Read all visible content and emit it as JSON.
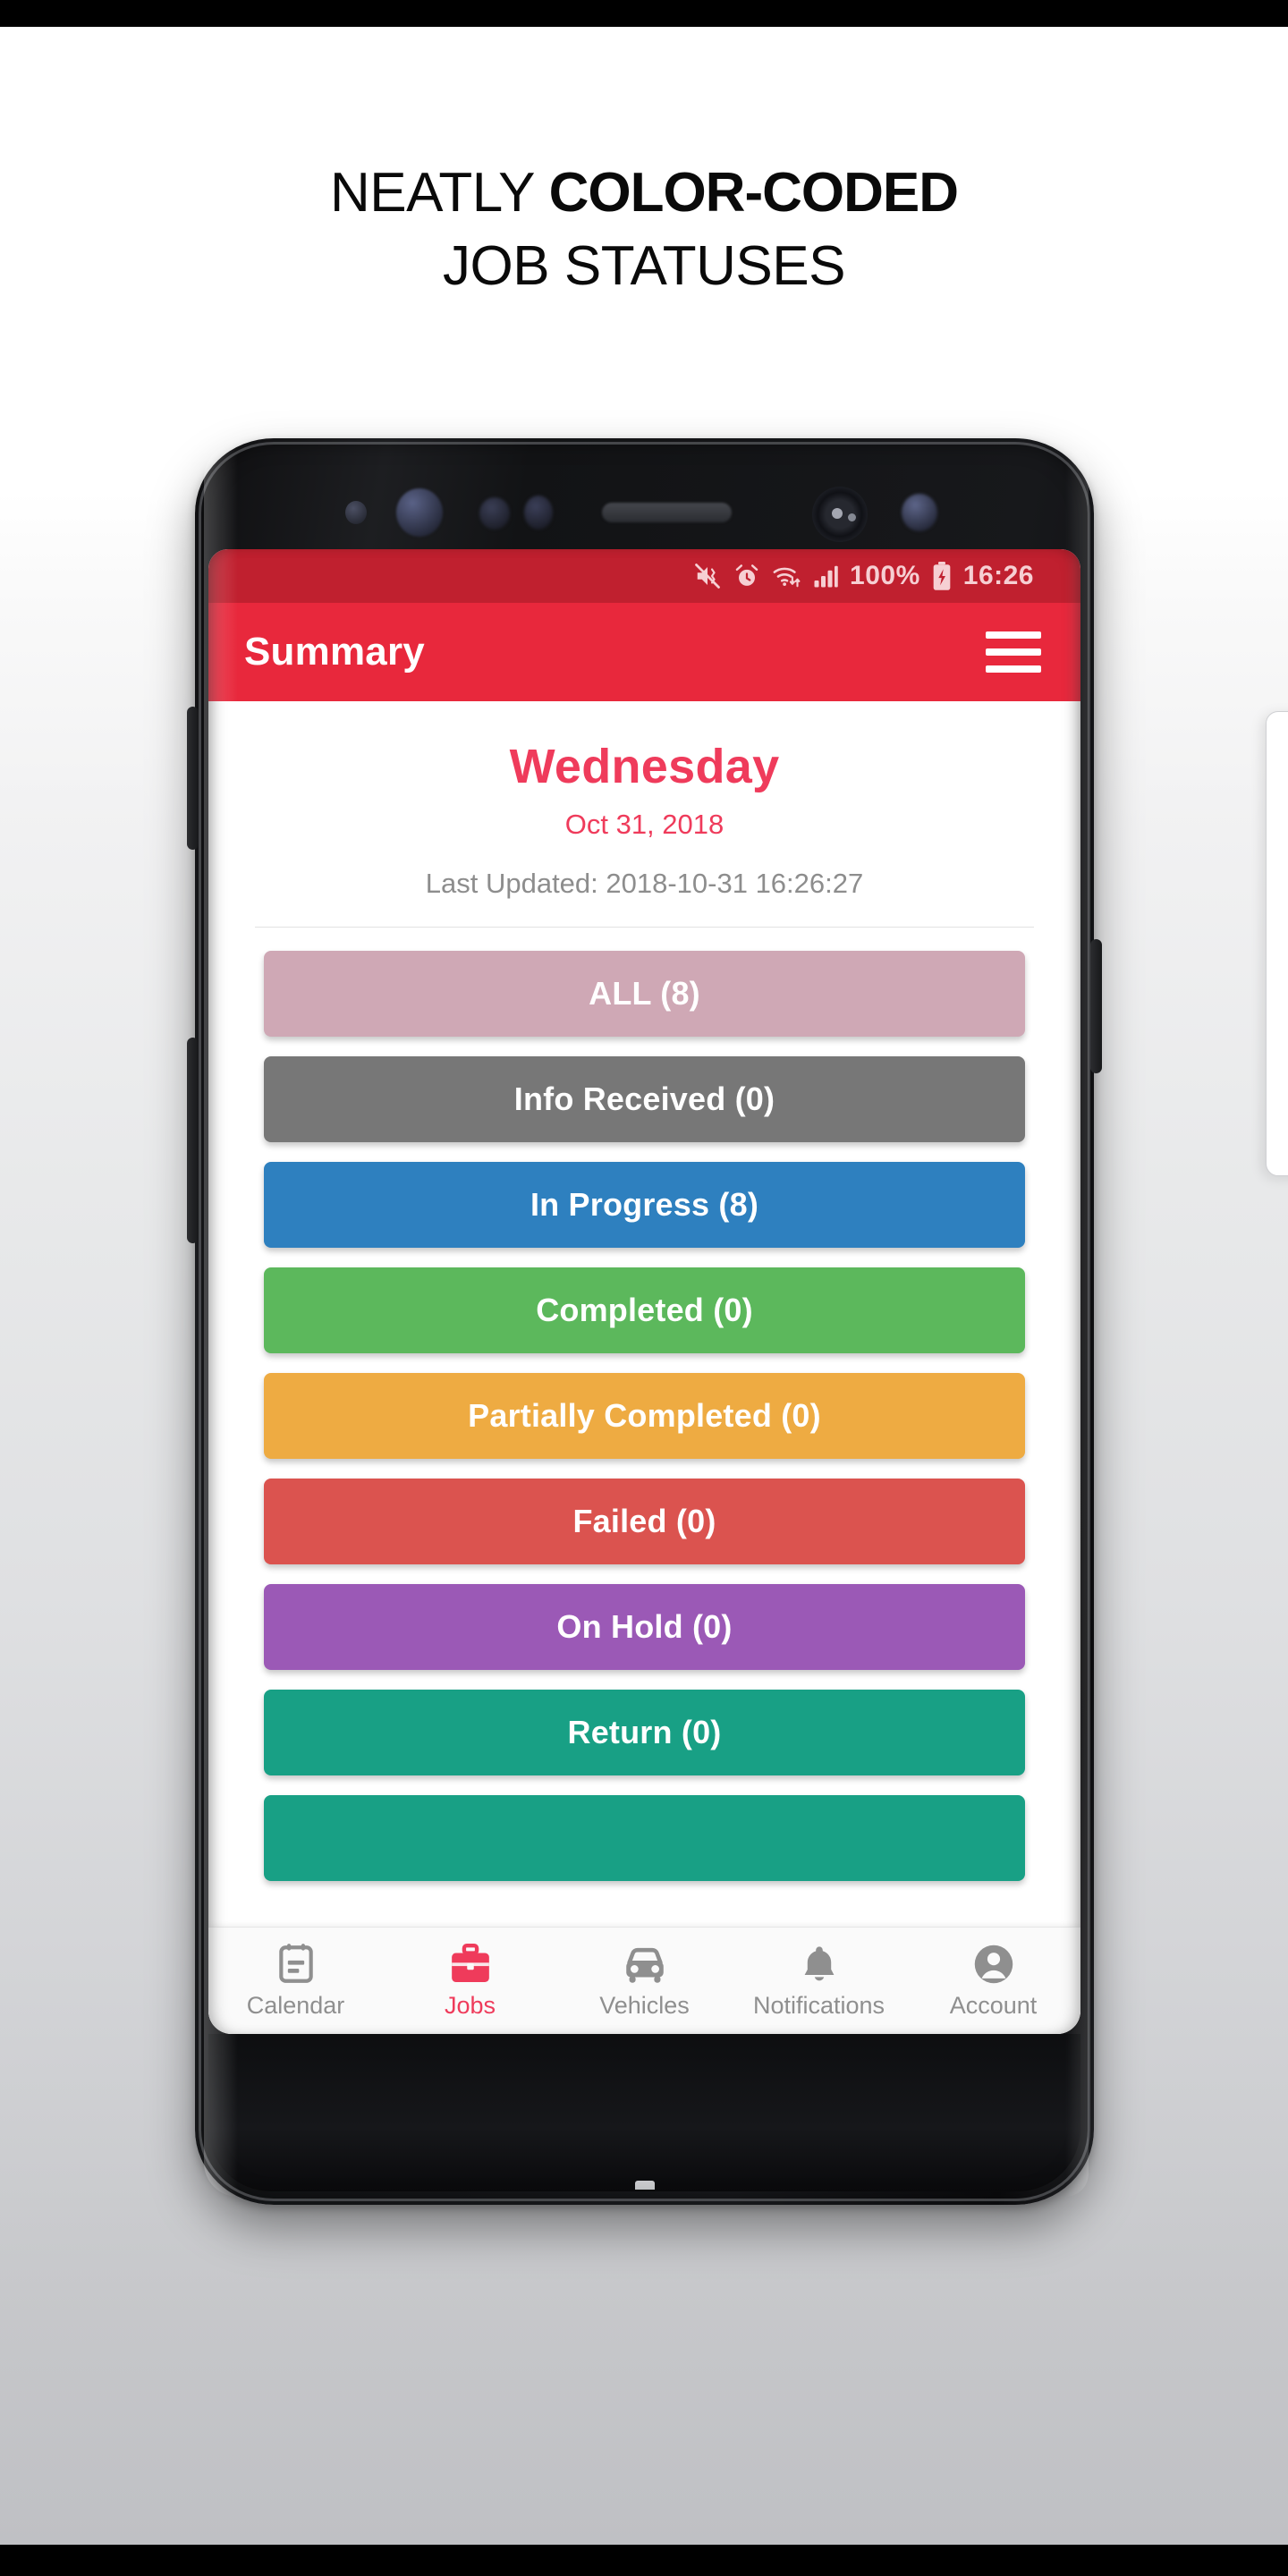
{
  "headline": {
    "line1_light": "NEATLY ",
    "line1_bold": "COLOR-CODED",
    "line2": "JOB STATUSES"
  },
  "statusbar": {
    "battery_percent": "100%",
    "time": "16:26",
    "icons": [
      "mute-vibrate-icon",
      "alarm-icon",
      "wifi-icon",
      "signal-bars-icon",
      "battery-charging-icon"
    ]
  },
  "appbar": {
    "title": "Summary",
    "menu_icon": "hamburger-menu-icon"
  },
  "summary": {
    "day": "Wednesday",
    "date": "Oct 31, 2018",
    "last_updated": "Last Updated: 2018-10-31 16:26:27"
  },
  "statuses": [
    {
      "label": "ALL (8)",
      "color": "#cfa8b5",
      "name": "status-all"
    },
    {
      "label": "Info Received (0)",
      "color": "#777777",
      "name": "status-info-received"
    },
    {
      "label": "In Progress (8)",
      "color": "#2e80bf",
      "name": "status-in-progress"
    },
    {
      "label": "Completed (0)",
      "color": "#5cb85c",
      "name": "status-completed"
    },
    {
      "label": "Partially Completed (0)",
      "color": "#eeab42",
      "name": "status-partially-completed"
    },
    {
      "label": "Failed (0)",
      "color": "#db534f",
      "name": "status-failed"
    },
    {
      "label": "On Hold (0)",
      "color": "#9b59b6",
      "name": "status-on-hold"
    },
    {
      "label": "Return (0)",
      "color": "#18a085",
      "name": "status-return"
    },
    {
      "label": "",
      "color": "#18a085",
      "name": "status-next-partial"
    }
  ],
  "bottom_nav": [
    {
      "label": "Calendar",
      "icon": "calendar-icon",
      "active": false
    },
    {
      "label": "Jobs",
      "icon": "briefcase-icon",
      "active": true
    },
    {
      "label": "Vehicles",
      "icon": "car-icon",
      "active": false
    },
    {
      "label": "Notifications",
      "icon": "bell-icon",
      "active": false
    },
    {
      "label": "Account",
      "icon": "person-icon",
      "active": false
    }
  ],
  "colors": {
    "brand_red": "#e8283c",
    "statusbar_red": "#c0202f",
    "accent_pink": "#ef3b5b",
    "nav_inactive": "#8f8f8f"
  }
}
